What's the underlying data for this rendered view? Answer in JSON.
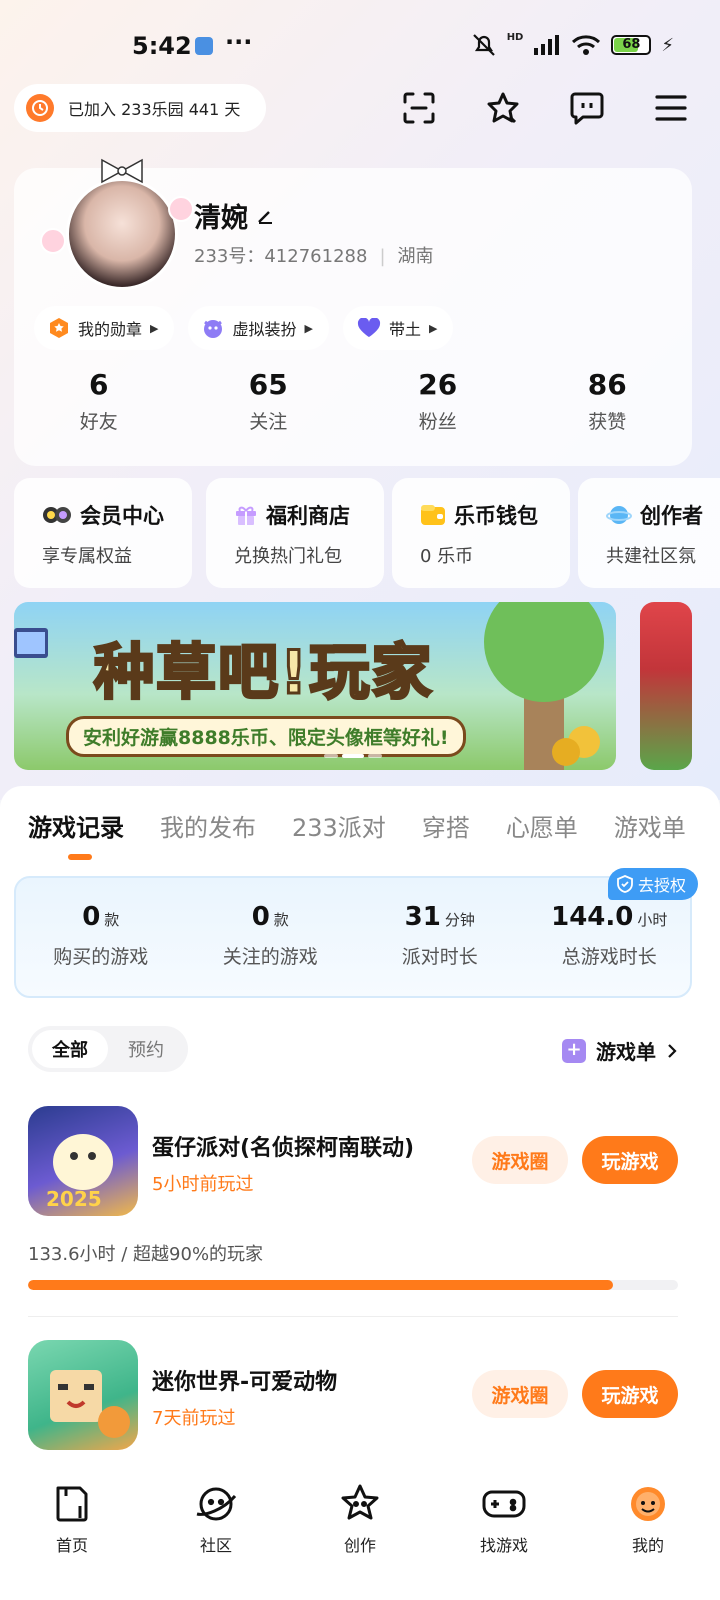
{
  "status_bar": {
    "time": "5:42",
    "dots": "···",
    "battery": "68",
    "hd": "HD"
  },
  "header": {
    "joined_text": "已加入 233乐园 441 天"
  },
  "profile": {
    "nickname": "清婉",
    "id_label": "233号：412761288",
    "region": "湖南",
    "chips": [
      {
        "label": "我的勋章"
      },
      {
        "label": "虚拟装扮"
      },
      {
        "label": "带土"
      }
    ],
    "stats": [
      {
        "value": "6",
        "label": "好友"
      },
      {
        "value": "65",
        "label": "关注"
      },
      {
        "value": "26",
        "label": "粉丝"
      },
      {
        "value": "86",
        "label": "获赞"
      }
    ]
  },
  "quick_cards": [
    {
      "title": "会员中心",
      "subtitle": "享专属权益",
      "icon": "vip-icon"
    },
    {
      "title": "福利商店",
      "subtitle": "兑换热门礼包",
      "icon": "gift-icon"
    },
    {
      "title": "乐币钱包",
      "subtitle": "0 乐币",
      "icon": "wallet-icon"
    },
    {
      "title": "创作者",
      "subtitle": "共建社区氛",
      "icon": "planet-icon"
    }
  ],
  "banner": {
    "title": "种草吧!玩家",
    "subtitle": "安利好游赢8888乐币、限定头像框等好礼!"
  },
  "tabs": [
    "游戏记录",
    "我的发布",
    "233派对",
    "穿搭",
    "心愿单",
    "游戏单"
  ],
  "game_stats": {
    "auth_badge": "去授权",
    "items": [
      {
        "value": "0",
        "unit": "款",
        "label": "购买的游戏"
      },
      {
        "value": "0",
        "unit": "款",
        "label": "关注的游戏"
      },
      {
        "value": "31",
        "unit": "分钟",
        "label": "派对时长"
      },
      {
        "value": "144.0",
        "unit": "小时",
        "label": "总游戏时长"
      }
    ]
  },
  "filter": {
    "all": "全部",
    "reserve": "预约",
    "game_list": "游戏单"
  },
  "games": [
    {
      "name": "蛋仔派对(名侦探柯南联动)",
      "played": "5小时前玩过",
      "circle_label": "游戏圈",
      "play_label": "玩游戏",
      "stat": "133.6小时 / 超越90%的玩家",
      "progress": 0.9
    },
    {
      "name": "迷你世界-可爱动物",
      "played": "7天前玩过",
      "circle_label": "游戏圈",
      "play_label": "玩游戏"
    }
  ],
  "bottom_nav": [
    {
      "label": "首页",
      "icon": "home-icon"
    },
    {
      "label": "社区",
      "icon": "community-icon"
    },
    {
      "label": "创作",
      "icon": "create-icon"
    },
    {
      "label": "找游戏",
      "icon": "gamepad-icon"
    },
    {
      "label": "我的",
      "icon": "profile-icon"
    }
  ],
  "colors": {
    "accent": "#ff7a1a",
    "link_blue": "#3e9cf5"
  }
}
